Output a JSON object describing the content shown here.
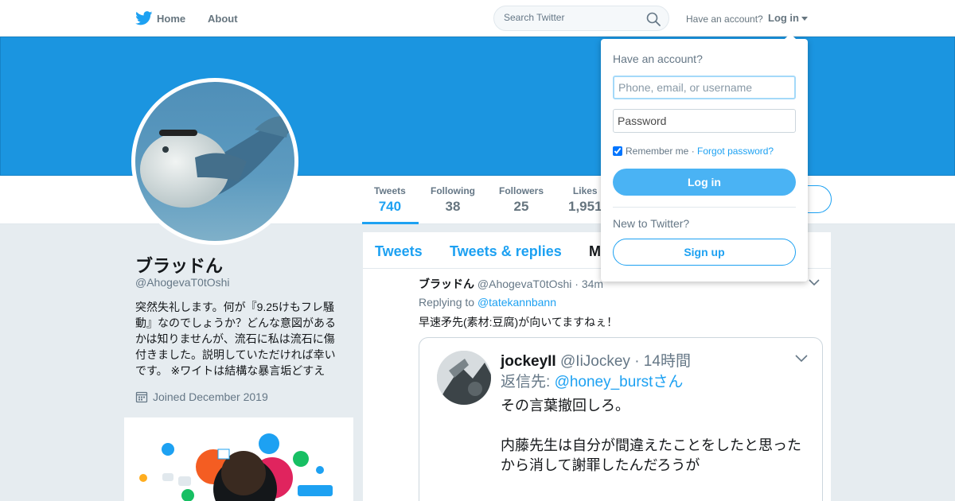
{
  "nav": {
    "home": "Home",
    "about": "About",
    "search_placeholder": "Search Twitter",
    "have_account": "Have an account?",
    "login": "Log in"
  },
  "profile": {
    "display_name": "ブラッドん",
    "handle": "@AhogevaT0tOshi",
    "bio": "突然失礼します。何が『9.25けもフレ騒動』なのでしょうか？どんな意図があるかは知りませんが、流石に私は流石に傷付きました。説明していただければ幸いです。 ※ワイトは結構な暴言垢どすえ",
    "joined": "Joined December 2019"
  },
  "stats": [
    {
      "label": "Tweets",
      "value": "740"
    },
    {
      "label": "Following",
      "value": "38"
    },
    {
      "label": "Followers",
      "value": "25"
    },
    {
      "label": "Likes",
      "value": "1,951"
    }
  ],
  "tabs": [
    "Tweets",
    "Tweets & replies",
    "M"
  ],
  "tweet": {
    "name": "ブラッドん",
    "handle": "@AhogevaT0tOshi",
    "time": "· 34m",
    "replying_label": "Replying to",
    "replying_to": "@tatekannbann",
    "text": "早速矛先(素材:豆腐)が向いてますねぇ！"
  },
  "quote": {
    "name": "jockeyII",
    "handle": "@IiJockey",
    "time": "· 14時間",
    "reply_label": "返信先:",
    "reply_to": "@honey_burstさん",
    "line1": "その言葉撤回しろ。",
    "line2": "内藤先生は自分が間違えたことをしたと思ったから消して謝罪したんだろうが"
  },
  "login_dropdown": {
    "title": "Have an account?",
    "username_placeholder": "Phone, email, or username",
    "password_placeholder": "Password",
    "remember": "Remember me",
    "separator": "·",
    "forgot": "Forgot password?",
    "login_button": "Log in",
    "new_label": "New to Twitter?",
    "signup_button": "Sign up"
  },
  "colors": {
    "accent": "#1da1f2",
    "banner": "#1b95e0",
    "login_button": "#4ab3f4"
  },
  "icons": [
    "twitter-bird-icon",
    "search-icon",
    "chevron-down-icon",
    "calendar-icon"
  ]
}
